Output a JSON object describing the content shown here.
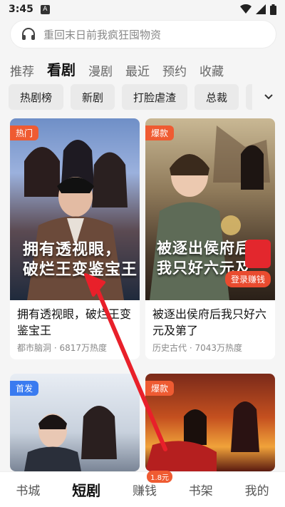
{
  "status_bar": {
    "time": "3:45",
    "notification_letter": "A"
  },
  "search": {
    "placeholder": "重回末日前我疯狂囤物资"
  },
  "category_tabs": [
    {
      "label": "推荐",
      "active": false
    },
    {
      "label": "看剧",
      "active": true
    },
    {
      "label": "漫剧",
      "active": false
    },
    {
      "label": "最近",
      "active": false
    },
    {
      "label": "预约",
      "active": false
    },
    {
      "label": "收藏",
      "active": false
    }
  ],
  "chips": [
    "热剧榜",
    "新剧",
    "打脸虐渣",
    "总裁"
  ],
  "cards": [
    {
      "badge": "热门",
      "badge_color": "#ef5b32",
      "poster_text": [
        "拥有透视眼，",
        "破烂王变鉴宝王"
      ],
      "title": "拥有透视眼，破烂王变鉴宝王",
      "meta": "都市脑洞 · 6817万热度"
    },
    {
      "badge": "爆款",
      "badge_color": "#ef5b32",
      "poster_text": [
        "被逐出侯府后",
        "我只好六元及"
      ],
      "title": "被逐出侯府后我只好六元及第了",
      "meta": "历史古代 · 7043万热度",
      "login_label": "登录赚钱"
    },
    {
      "badge": "首发",
      "badge_color": "#3a7bf0"
    },
    {
      "badge": "爆款",
      "badge_color": "#ef5b32"
    }
  ],
  "bottom_nav": [
    {
      "label": "书城",
      "active": false
    },
    {
      "label": "短剧",
      "active": true
    },
    {
      "label": "赚钱",
      "active": false,
      "pill": "1.8元"
    },
    {
      "label": "书架",
      "active": false
    },
    {
      "label": "我的",
      "active": false
    }
  ],
  "colors": {
    "accent": "#ef5b32",
    "arrow": "#e8202a"
  }
}
